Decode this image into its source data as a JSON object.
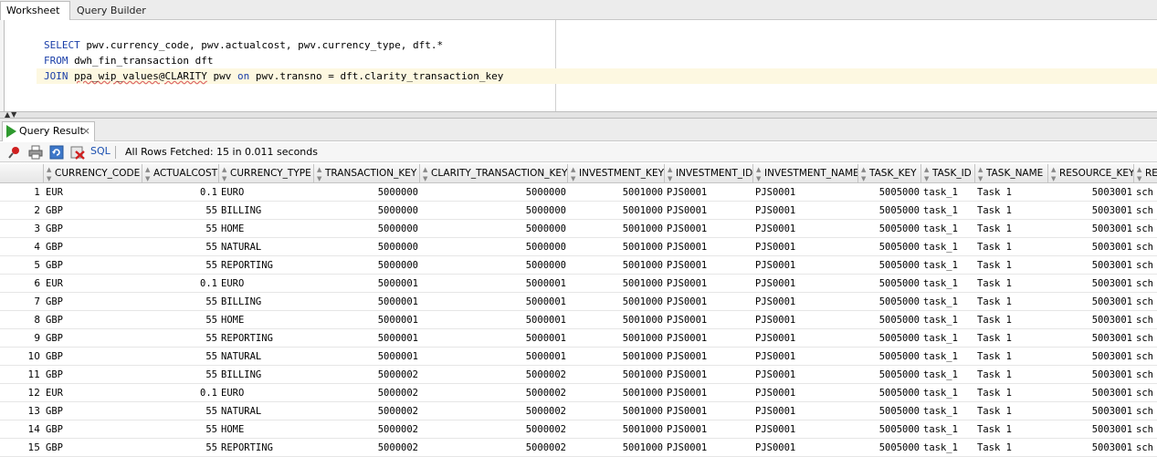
{
  "tabs": {
    "worksheet": "Worksheet",
    "query_builder": "Query Builder"
  },
  "editor": {
    "line1": {
      "kw": "SELECT",
      "rest": " pwv.currency_code, pwv.actualcost, pwv.currency_type, dft.*"
    },
    "line2": {
      "kw": "FROM",
      "rest": " dwh_fin_transaction dft"
    },
    "line3": {
      "kw": "JOIN",
      "sp": " ",
      "link": "ppa_wip_values@CLARITY",
      "pre_on": " pwv ",
      "on": "on",
      "rest": " pwv.transno = dft.clarity_transaction_key"
    }
  },
  "result_tab": {
    "label": "Query Result",
    "close": "×"
  },
  "toolbar": {
    "sql": "SQL",
    "status": "All Rows Fetched: 15 in 0.011 seconds"
  },
  "icons": {
    "pin": "pin-icon",
    "print": "print-icon",
    "refresh": "refresh-icon",
    "delete": "delete-icon",
    "run": "play-icon"
  },
  "colors": {
    "keyword": "#1a3ea8",
    "current_line": "#fdf8e1",
    "run_icon": "#2f9a2f"
  },
  "columns": [
    "CURRENCY_CODE",
    "ACTUALCOST",
    "CURRENCY_TYPE",
    "TRANSACTION_KEY",
    "CLARITY_TRANSACTION_KEY",
    "INVESTMENT_KEY",
    "INVESTMENT_ID",
    "INVESTMENT_NAME",
    "TASK_KEY",
    "TASK_ID",
    "TASK_NAME",
    "RESOURCE_KEY",
    "RE"
  ],
  "rows": [
    [
      "1",
      "EUR",
      "0.1",
      "EURO",
      "5000000",
      "5000000",
      "5001000",
      "PJS0001",
      "PJS0001",
      "5005000",
      "task_1",
      "Task 1",
      "5003001",
      "sch"
    ],
    [
      "2",
      "GBP",
      "55",
      "BILLING",
      "5000000",
      "5000000",
      "5001000",
      "PJS0001",
      "PJS0001",
      "5005000",
      "task_1",
      "Task 1",
      "5003001",
      "sch"
    ],
    [
      "3",
      "GBP",
      "55",
      "HOME",
      "5000000",
      "5000000",
      "5001000",
      "PJS0001",
      "PJS0001",
      "5005000",
      "task_1",
      "Task 1",
      "5003001",
      "sch"
    ],
    [
      "4",
      "GBP",
      "55",
      "NATURAL",
      "5000000",
      "5000000",
      "5001000",
      "PJS0001",
      "PJS0001",
      "5005000",
      "task_1",
      "Task 1",
      "5003001",
      "sch"
    ],
    [
      "5",
      "GBP",
      "55",
      "REPORTING",
      "5000000",
      "5000000",
      "5001000",
      "PJS0001",
      "PJS0001",
      "5005000",
      "task_1",
      "Task 1",
      "5003001",
      "sch"
    ],
    [
      "6",
      "EUR",
      "0.1",
      "EURO",
      "5000001",
      "5000001",
      "5001000",
      "PJS0001",
      "PJS0001",
      "5005000",
      "task_1",
      "Task 1",
      "5003001",
      "sch"
    ],
    [
      "7",
      "GBP",
      "55",
      "BILLING",
      "5000001",
      "5000001",
      "5001000",
      "PJS0001",
      "PJS0001",
      "5005000",
      "task_1",
      "Task 1",
      "5003001",
      "sch"
    ],
    [
      "8",
      "GBP",
      "55",
      "HOME",
      "5000001",
      "5000001",
      "5001000",
      "PJS0001",
      "PJS0001",
      "5005000",
      "task_1",
      "Task 1",
      "5003001",
      "sch"
    ],
    [
      "9",
      "GBP",
      "55",
      "REPORTING",
      "5000001",
      "5000001",
      "5001000",
      "PJS0001",
      "PJS0001",
      "5005000",
      "task_1",
      "Task 1",
      "5003001",
      "sch"
    ],
    [
      "10",
      "GBP",
      "55",
      "NATURAL",
      "5000001",
      "5000001",
      "5001000",
      "PJS0001",
      "PJS0001",
      "5005000",
      "task_1",
      "Task 1",
      "5003001",
      "sch"
    ],
    [
      "11",
      "GBP",
      "55",
      "BILLING",
      "5000002",
      "5000002",
      "5001000",
      "PJS0001",
      "PJS0001",
      "5005000",
      "task_1",
      "Task 1",
      "5003001",
      "sch"
    ],
    [
      "12",
      "EUR",
      "0.1",
      "EURO",
      "5000002",
      "5000002",
      "5001000",
      "PJS0001",
      "PJS0001",
      "5005000",
      "task_1",
      "Task 1",
      "5003001",
      "sch"
    ],
    [
      "13",
      "GBP",
      "55",
      "NATURAL",
      "5000002",
      "5000002",
      "5001000",
      "PJS0001",
      "PJS0001",
      "5005000",
      "task_1",
      "Task 1",
      "5003001",
      "sch"
    ],
    [
      "14",
      "GBP",
      "55",
      "HOME",
      "5000002",
      "5000002",
      "5001000",
      "PJS0001",
      "PJS0001",
      "5005000",
      "task_1",
      "Task 1",
      "5003001",
      "sch"
    ],
    [
      "15",
      "GBP",
      "55",
      "REPORTING",
      "5000002",
      "5000002",
      "5001000",
      "PJS0001",
      "PJS0001",
      "5005000",
      "task_1",
      "Task 1",
      "5003001",
      "sch"
    ]
  ]
}
